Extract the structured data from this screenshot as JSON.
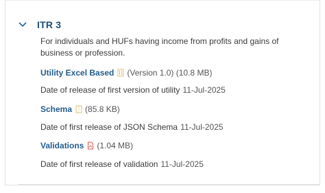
{
  "section": {
    "title": "ITR 3",
    "description": "For individuals and HUFs having income from profits and gains of business or profession."
  },
  "items": {
    "utility": {
      "label": "Utility Excel Based",
      "meta": "(Version 1.0) (10.8 MB)",
      "icon": "excel-file-icon"
    },
    "utility_release": {
      "label": "Date of release of first version of utility",
      "date": "11-Jul-2025"
    },
    "schema": {
      "label": "Schema",
      "meta": "(85.8 KB)",
      "icon": "zip-file-icon"
    },
    "schema_release": {
      "label": "Date of first release of JSON Schema",
      "date": "11-Jul-2025"
    },
    "validations": {
      "label": "Validations",
      "meta": "(1.04 MB)",
      "icon": "pdf-file-icon"
    },
    "validation_release": {
      "label": "Date of first release of validation",
      "date": "11-Jul-2025"
    }
  },
  "colors": {
    "title": "#1f4e79",
    "link": "#235c8c",
    "excel_icon": "#d9c27b",
    "pdf_icon": "#d9534f"
  }
}
